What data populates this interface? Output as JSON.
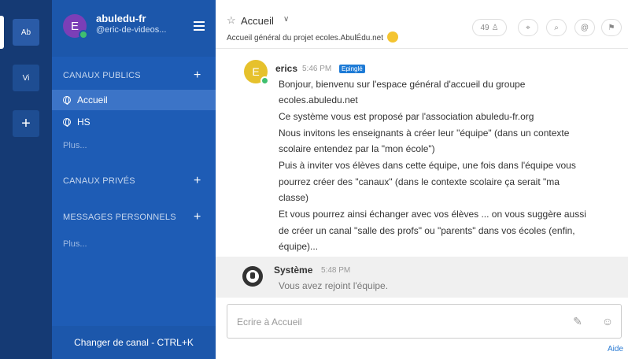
{
  "teams_sidebar": {
    "teams": [
      {
        "initials": "Ab"
      },
      {
        "initials": "Vi"
      }
    ],
    "add_label": "+"
  },
  "sidebar": {
    "team_name": "abuledu-fr",
    "user_handle": "@eric-de-videos...",
    "avatar_letter": "E",
    "public_title": "CANAUX PUBLICS",
    "channels": [
      {
        "label": "Accueil"
      },
      {
        "label": "HS"
      }
    ],
    "more_public": "Plus...",
    "private_title": "CANAUX PRIVÉS",
    "dm_title": "MESSAGES PERSONNELS",
    "more_dm": "Plus...",
    "switch_label": "Changer de canal - CTRL+K"
  },
  "channel_header": {
    "name": "Accueil",
    "purpose": "Accueil général du projet ecoles.AbulÉdu.net",
    "member_count": "49"
  },
  "posts": [
    {
      "author": "erics",
      "avatar_letter": "E",
      "time": "5:46 PM",
      "badge": "Epinglé",
      "lines": [
        "Bonjour, bienvenu sur l'espace général d'accueil du groupe",
        "ecoles.abuledu.net",
        "Ce système vous est proposé par l'association abuledu-fr.org",
        "Nous invitons les enseignants à créer leur \"équipe\" (dans un contexte",
        "scolaire entendez par la \"mon école\")",
        "Puis à inviter vos élèves dans cette équipe, une fois dans l'équipe vous",
        "pourrez créer des \"canaux\" (dans le contexte scolaire ça serait \"ma",
        "classe)",
        "Et vous pourrez ainsi échanger avec vos élèves ... on vous suggère aussi",
        "de créer un canal \"salle des profs\" ou \"parents\" dans vos écoles (enfin,",
        "équipe)..."
      ]
    }
  ],
  "system_post": {
    "author": "Système",
    "time": "5:48 PM",
    "text": "Vous avez rejoint l'équipe."
  },
  "composer": {
    "placeholder": "Ecrire à Accueil"
  },
  "help_link": "Aide",
  "colors": {
    "teams_bg": "#153a74",
    "sidebar_bg": "#1e5cb5",
    "active_channel": "#3c74c7",
    "online": "#3fbf6f",
    "pinned_badge": "#1e7bd6"
  }
}
